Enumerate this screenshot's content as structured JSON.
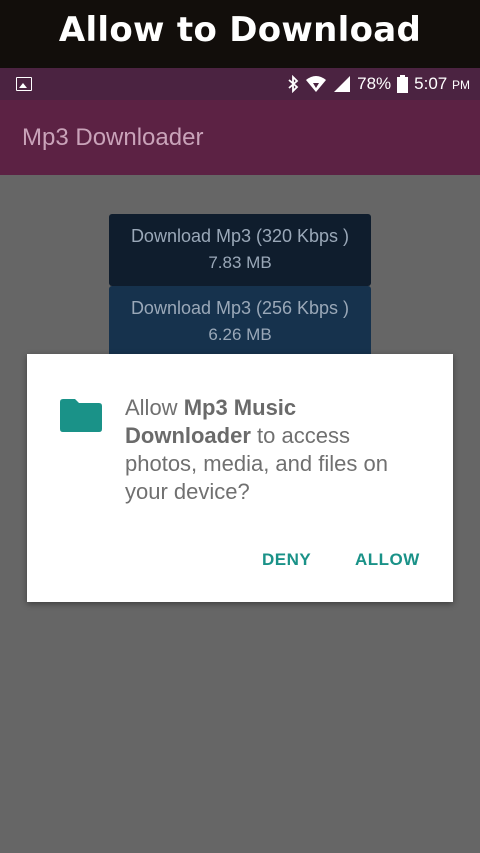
{
  "banner": {
    "title": "Allow to Download"
  },
  "status_bar": {
    "battery": "78%",
    "time": "5:07",
    "ampm": "PM"
  },
  "app_bar": {
    "title": "Mp3 Downloader"
  },
  "downloads": [
    {
      "label": "Download Mp3 (320 Kbps )",
      "size": "7.83 MB"
    },
    {
      "label": "Download Mp3 (256 Kbps )",
      "size": "6.26 MB"
    }
  ],
  "dialog": {
    "prefix": "Allow ",
    "app_name": "Mp3 Music Downloader",
    "suffix": " to access photos, media, and files on your device?",
    "icon": "folder-icon",
    "deny": "DENY",
    "allow": "ALLOW"
  },
  "colors": {
    "accent": "#1a9288",
    "app_bar": "#5c2244",
    "status_bar": "#4b2341"
  }
}
